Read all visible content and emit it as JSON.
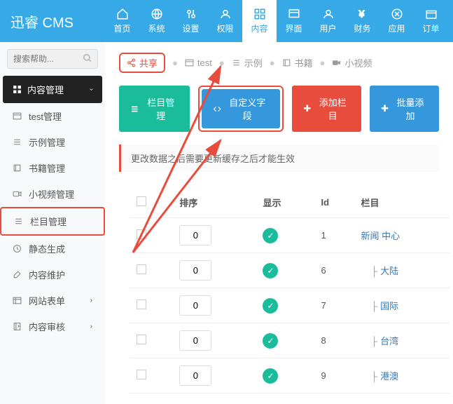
{
  "logo": "迅睿 CMS",
  "nav": [
    {
      "label": "首页"
    },
    {
      "label": "系统"
    },
    {
      "label": "设置"
    },
    {
      "label": "权限"
    },
    {
      "label": "内容",
      "active": true
    },
    {
      "label": "界面"
    },
    {
      "label": "用户"
    },
    {
      "label": "财务"
    },
    {
      "label": "应用"
    },
    {
      "label": "订单"
    }
  ],
  "search": {
    "placeholder": "搜索帮助..."
  },
  "sidebar": {
    "section_content": "内容管理",
    "items": [
      "test管理",
      "示例管理",
      "书籍管理",
      "小视频管理",
      "栏目管理",
      "静态生成",
      "内容维护"
    ],
    "section_form": "网站表单",
    "section_review": "内容审核"
  },
  "breadcrumb": {
    "share": "共享",
    "test": "test",
    "example": "示例",
    "book": "书籍",
    "video": "小视频"
  },
  "actions": {
    "col_manage": "栏目管理",
    "custom_field": "自定义字段",
    "add_col": "添加栏目",
    "batch_add": "批量添加"
  },
  "notice": "更改数据之后需要更新缓存之后才能生效",
  "table": {
    "headers": {
      "sort": "排序",
      "show": "显示",
      "id": "Id",
      "col": "栏目"
    },
    "rows": [
      {
        "sort": 0,
        "show": true,
        "id": 1,
        "name": "新闻 中心",
        "indent": 0
      },
      {
        "sort": 0,
        "show": true,
        "id": 6,
        "name": "大陆",
        "indent": 1
      },
      {
        "sort": 0,
        "show": true,
        "id": 7,
        "name": "国际",
        "indent": 1
      },
      {
        "sort": 0,
        "show": true,
        "id": 8,
        "name": "台湾",
        "indent": 1
      },
      {
        "sort": 0,
        "show": true,
        "id": 9,
        "name": "港澳",
        "indent": 1
      }
    ]
  }
}
